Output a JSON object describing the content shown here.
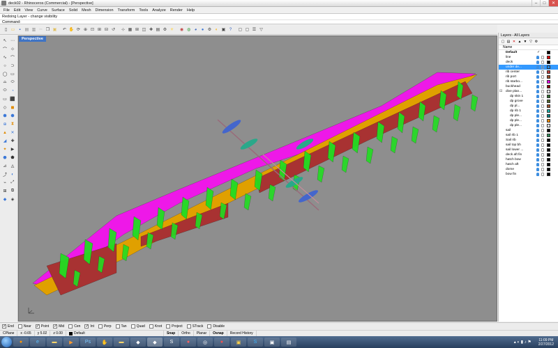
{
  "window": {
    "title": "deck02 - Rhinoceros (Commercial) - [Perspective]",
    "icon": "rhino-icon"
  },
  "menu": [
    "File",
    "Edit",
    "View",
    "Curve",
    "Surface",
    "Solid",
    "Mesh",
    "Dimension",
    "Transform",
    "Tools",
    "Analyze",
    "Render",
    "Help"
  ],
  "command": {
    "history": "Redoing Layer - change visibility",
    "prompt": "Command:",
    "value": ""
  },
  "viewport": {
    "tab": "Perspective",
    "background": "#8e8e8e"
  },
  "layers_panel": {
    "title": "Layers - All Layers",
    "column_name": "Name",
    "layers": [
      {
        "name": "Default",
        "color": "#000000",
        "indent": 0,
        "default": true
      },
      {
        "name": "line",
        "color": "#ff0000",
        "indent": 0
      },
      {
        "name": "deck",
        "color": "#000000",
        "indent": 0
      },
      {
        "name": "under de...",
        "color": "#1e90ff",
        "indent": 0,
        "selected": true
      },
      {
        "name": "rib center",
        "color": "#c04040",
        "indent": 0
      },
      {
        "name": "rib port",
        "color": "#a0522d",
        "indent": 0
      },
      {
        "name": "rib starbo...",
        "color": "#ff00ff",
        "indent": 0
      },
      {
        "name": "buckhead",
        "color": "#8b0000",
        "indent": 0
      },
      {
        "name": "dive plan...",
        "color": "#ffffff",
        "indent": 0,
        "expand": "⊟"
      },
      {
        "name": "dp skin 1",
        "color": "#2e6e2e",
        "indent": 1
      },
      {
        "name": "dp grove",
        "color": "#556b2f",
        "indent": 1
      },
      {
        "name": "dp pl...",
        "color": "#a0522d",
        "indent": 1
      },
      {
        "name": "dp rib 1",
        "color": "#20b2aa",
        "indent": 1
      },
      {
        "name": "dp ple...",
        "color": "#008080",
        "indent": 1
      },
      {
        "name": "dp ple...",
        "color": "#ff8c00",
        "indent": 1
      },
      {
        "name": "dp ple...",
        "color": "#ffffff",
        "indent": 1
      },
      {
        "name": "sail",
        "color": "#000000",
        "indent": 0
      },
      {
        "name": "sail rib 1",
        "color": "#2e8b57",
        "indent": 0
      },
      {
        "name": "Sail rib",
        "color": "#000000",
        "indent": 0
      },
      {
        "name": "sail top bh",
        "color": "#000000",
        "indent": 0
      },
      {
        "name": "sail lower ...",
        "color": "#000000",
        "indent": 0
      },
      {
        "name": "deck aft fin",
        "color": "#000000",
        "indent": 0
      },
      {
        "name": "hatch bow",
        "color": "#000000",
        "indent": 0
      },
      {
        "name": "hatch aft",
        "color": "#000000",
        "indent": 0
      },
      {
        "name": "dome",
        "color": "#000000",
        "indent": 0
      },
      {
        "name": "bow fin",
        "color": "#000000",
        "indent": 0
      }
    ]
  },
  "osnaps": [
    {
      "label": "End",
      "checked": true
    },
    {
      "label": "Near",
      "checked": false
    },
    {
      "label": "Point",
      "checked": true
    },
    {
      "label": "Mid",
      "checked": true
    },
    {
      "label": "Cen",
      "checked": false
    },
    {
      "label": "Int",
      "checked": true
    },
    {
      "label": "Perp",
      "checked": false
    },
    {
      "label": "Tan",
      "checked": false
    },
    {
      "label": "Quad",
      "checked": false
    },
    {
      "label": "Knot",
      "checked": false
    },
    {
      "label": "Project",
      "checked": false
    },
    {
      "label": "STrack",
      "checked": false
    },
    {
      "label": "Disable",
      "checked": false
    }
  ],
  "status": {
    "cplane": "CPlane",
    "x": "x -0.65",
    "y": "y 5.02",
    "z": "z 0.00",
    "layer": "Default",
    "snap": "Snap",
    "ortho": "Ortho",
    "planar": "Planar",
    "osnap": "Osnap",
    "record": "Record History"
  },
  "taskbar": {
    "time": "11:09 PM",
    "date": "2/27/2012"
  },
  "colors": {
    "magenta": "#ee18e8",
    "orange": "#e0a000",
    "red": "#a83232",
    "green": "#22dd22",
    "accent": "#3f74c5"
  }
}
